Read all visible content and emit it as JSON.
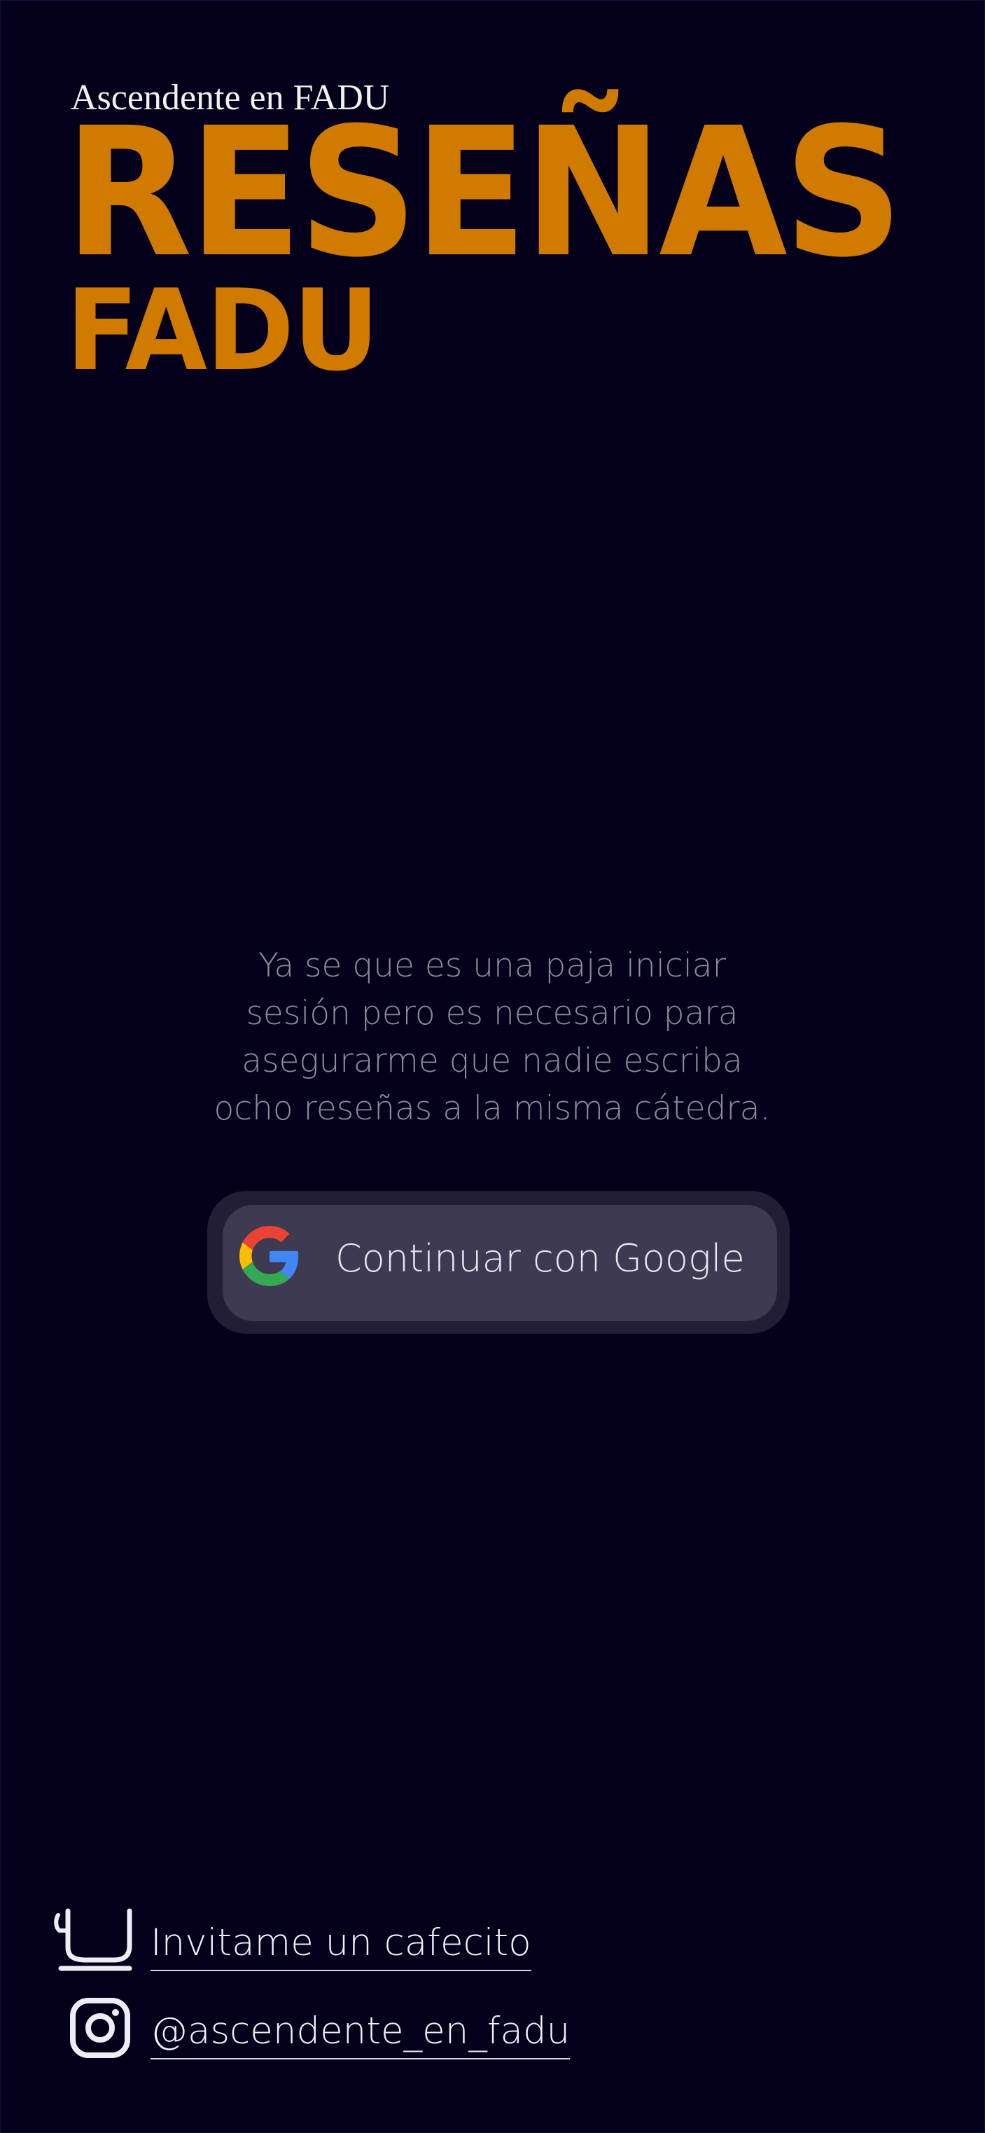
{
  "brand": {
    "subtitle": "Ascendente en FADU",
    "title_line1": "RESEÑAS",
    "title_line2": "FADU"
  },
  "login": {
    "message_lines": [
      "Ya se que es una paja iniciar",
      "sesión pero es necesario para",
      "asegurarme que nadie escriba",
      "ocho reseñas a la misma cátedra."
    ],
    "google_button_label": "Continuar con Google",
    "google_button_icon": "google-logo-icon"
  },
  "footer": {
    "coffee_label": "Invitame un cafecito",
    "coffee_icon": "coffee-cup-icon",
    "instagram_label": "@ascendente_en_fadu",
    "instagram_icon": "instagram-icon"
  },
  "colors": {
    "background": "#04001c",
    "brand_orange": "#d17a00",
    "message_gray": "#8e8c99",
    "button_fill": "#3e3a52",
    "button_shadow": "#211e36",
    "footer_text": "#f1f0f5"
  }
}
